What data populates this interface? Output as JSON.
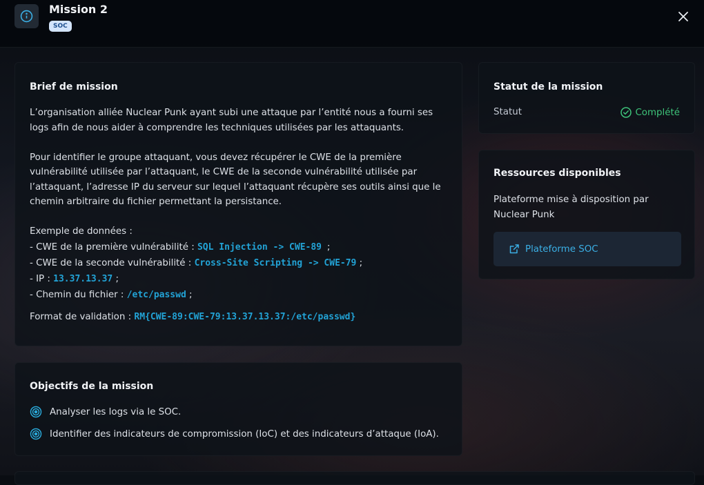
{
  "header": {
    "title": "Mission 2",
    "badge": "SOC",
    "icons": {
      "info": "info-icon",
      "close": "close-icon"
    }
  },
  "brief": {
    "title": "Brief de mission",
    "paragraph1": "L’organisation alliée Nuclear Punk ayant subi une attaque par l’entité nous a fourni ses logs afin de nous aider à comprendre les techniques utilisées par les attaquants.",
    "paragraph2": "Pour identifier le groupe attaquant, vous devez récupérer le CWE de la première vulnérabilité utilisée par l’attaquant, le CWE de la seconde vulnérabilité utilisée par l’attaquant, l’adresse IP du serveur sur lequel l’attaquant récupère ses outils ainsi que le chemin arbitraire du fichier permettant la persistance.",
    "examples_heading": "Exemple de données :",
    "examples": [
      {
        "label": "- CWE de la première vulnérabilité : ",
        "value": "SQL Injection -> CWE-89 ",
        "suffix": ";"
      },
      {
        "label": "- CWE de la seconde vulnérabilité : ",
        "value": "Cross-Site Scripting -> CWE-79",
        "suffix": ";"
      },
      {
        "label": "- IP : ",
        "value": "13.37.13.37",
        "suffix": ";"
      },
      {
        "label": "- Chemin du fichier : ",
        "value": "/etc/passwd",
        "suffix": ";"
      }
    ],
    "format_label": "Format de validation : ",
    "format_value": "RM{CWE-89:CWE-79:13.37.13.37:/etc/passwd}"
  },
  "objectives": {
    "title": "Objectifs de la mission",
    "items": [
      "Analyser les logs via le SOC.",
      "Identifier des indicateurs de compromission (IoC) et des indicateurs d’attaque (IoA)."
    ],
    "item_icon": "target-icon"
  },
  "status": {
    "title": "Statut de la mission",
    "label": "Statut",
    "value": "Complété",
    "value_icon": "check-circle-icon",
    "color": "#3ec47a"
  },
  "resources": {
    "title": "Ressources disponibles",
    "description": "Plateforme mise à disposition par Nuclear Punk",
    "link_label": "Plateforme SOC",
    "link_icon": "external-link-icon",
    "accent": "#3bb0e6"
  }
}
